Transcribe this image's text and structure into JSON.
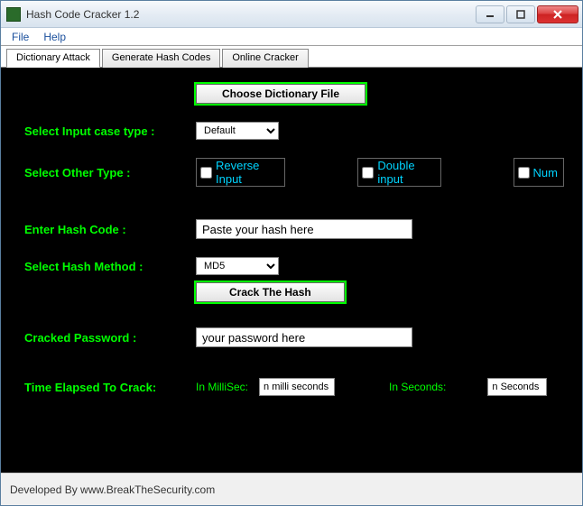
{
  "window": {
    "title": "Hash Code Cracker 1.2"
  },
  "menubar": {
    "file": "File",
    "help": "Help"
  },
  "tabs": {
    "dictionary": "Dictionary Attack",
    "generate": "Generate Hash Codes",
    "online": "Online Cracker"
  },
  "form": {
    "choose_file_btn": "Choose Dictionary File",
    "case_label": "Select Input case type :",
    "case_value": "Default",
    "other_label": "Select Other Type :",
    "reverse_label": "Reverse Input",
    "double_label": "Double input",
    "num_label": "Num",
    "hash_label": "Enter Hash Code :",
    "hash_placeholder": "Paste your hash here",
    "method_label": "Select Hash Method :",
    "method_value": "MD5",
    "crack_btn": "Crack The Hash",
    "cracked_label": "Cracked Password :",
    "cracked_placeholder": "your password here",
    "elapsed_label": "Time Elapsed To Crack:",
    "millisec_label": "In MilliSec:",
    "millisec_value": "n milli seconds",
    "seconds_label": "In Seconds:",
    "seconds_value": "n Seconds"
  },
  "footer": {
    "text": "Developed By www.BreakTheSecurity.com"
  }
}
